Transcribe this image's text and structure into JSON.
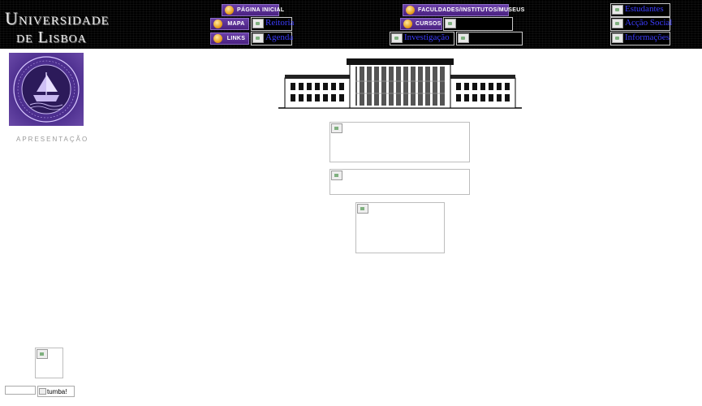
{
  "logo": {
    "line1": "Universidade",
    "line2": "de Lisboa"
  },
  "nav_buttons": {
    "home": "PÁGINA INICIAL",
    "faculties": "FACULDADES/INSTITUTOS/MUSEUS",
    "map": "MAPA",
    "courses": "CURSOS",
    "links": "LINKS"
  },
  "image_links": {
    "reitoria": "Reitoria",
    "agenda": "Agenda",
    "investigacao": "Investigação",
    "estudantes": "Estudantes",
    "acao_social": "Acção Social",
    "informacoes": "Informações"
  },
  "seal_caption": "APRESENTAÇÃO",
  "footer": {
    "tumba_alt": "tumba!"
  },
  "colors": {
    "header_bg": "#000000",
    "button_purple": "#4a2180",
    "link_blue": "#3d3dff",
    "seal_purple": "#4a2c8c"
  }
}
